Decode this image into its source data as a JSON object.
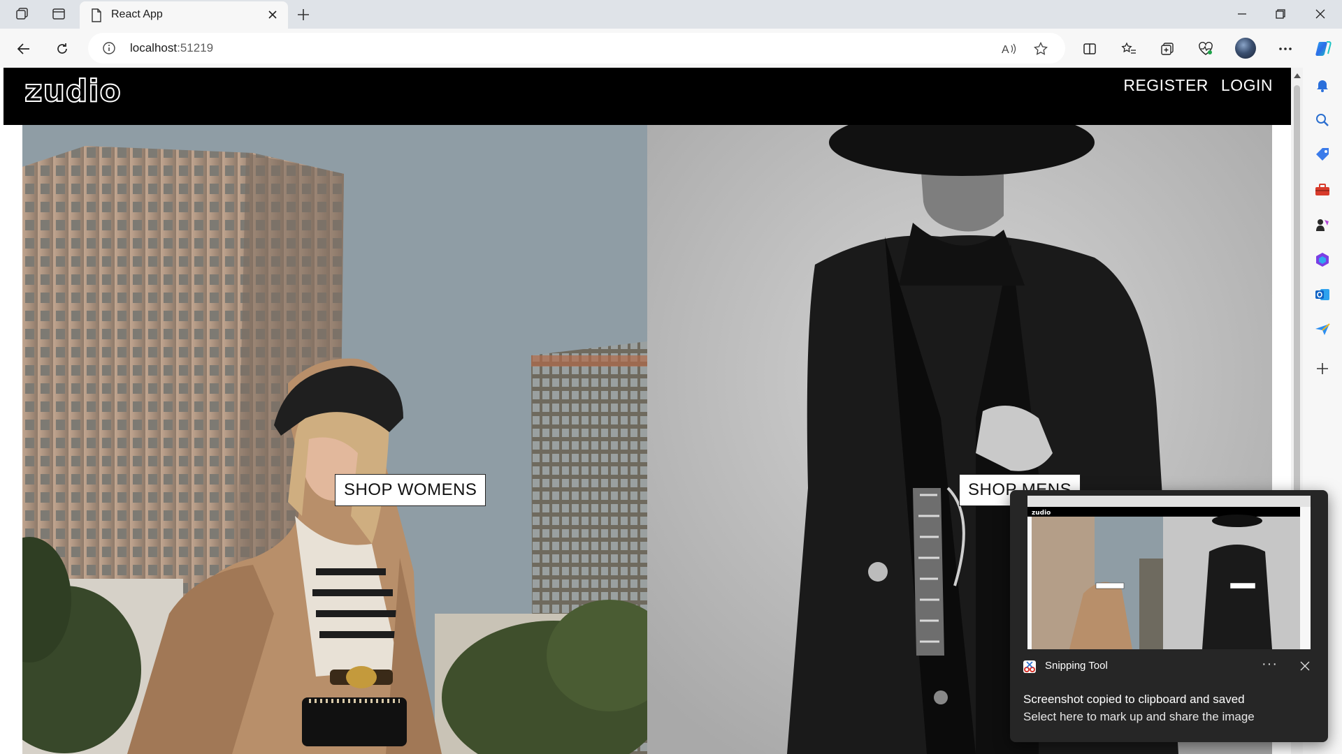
{
  "browser": {
    "tab_title": "React App",
    "url_host": "localhost",
    "url_port": ":51219"
  },
  "site": {
    "logo": "zudio",
    "nav": {
      "register": "REGISTER",
      "login": "LOGIN"
    },
    "hero": {
      "women_button": "SHOP WOMENS",
      "men_button": "SHOP MENS"
    }
  },
  "toast": {
    "app_name": "Snipping Tool",
    "title": "Screenshot copied to clipboard and saved",
    "subtitle": "Select here to mark up and share the image"
  }
}
